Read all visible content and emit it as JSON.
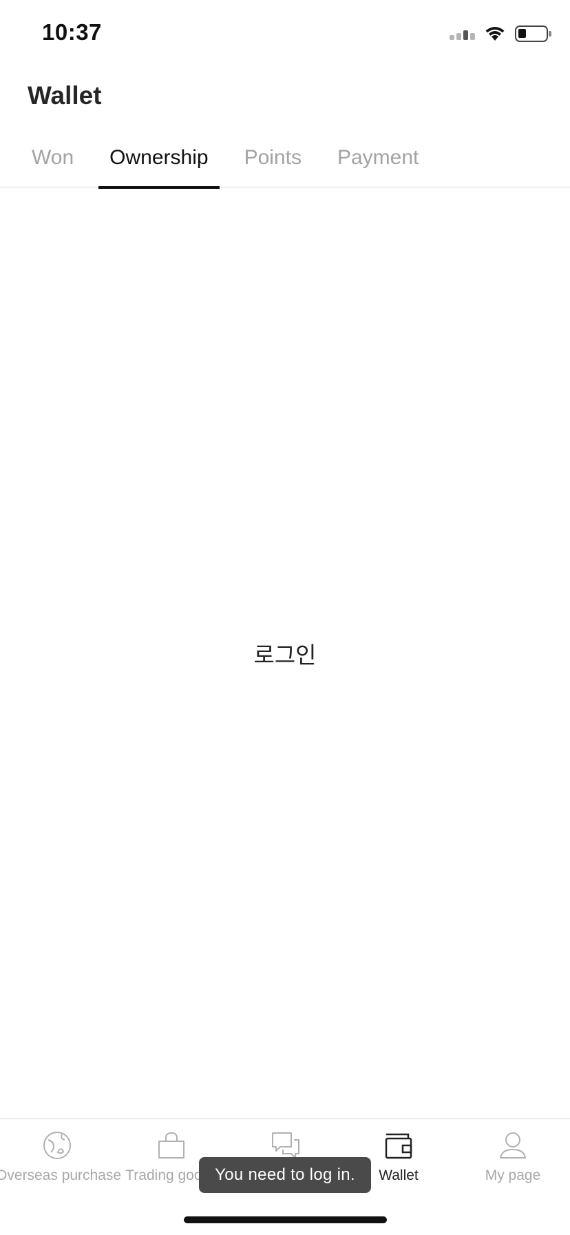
{
  "status_bar": {
    "time": "10:37",
    "icons": [
      "cellular-signal-icon",
      "wifi-icon",
      "battery-icon"
    ]
  },
  "header": {
    "title": "Wallet"
  },
  "tabs": [
    {
      "label": "Won",
      "active": false
    },
    {
      "label": "Ownership",
      "active": true
    },
    {
      "label": "Points",
      "active": false
    },
    {
      "label": "Payment",
      "active": false
    }
  ],
  "main": {
    "login_text": "로그인"
  },
  "bottom_nav": {
    "items": [
      {
        "label": "Overseas purchase",
        "icon": "globe-icon",
        "active": false
      },
      {
        "label": "Trading goods",
        "icon": "shopping-bag-icon",
        "active": false
      },
      {
        "label": "",
        "icon": "chat-icon",
        "active": false
      },
      {
        "label": "Wallet",
        "icon": "wallet-icon",
        "active": true
      },
      {
        "label": "My page",
        "icon": "user-icon",
        "active": false
      }
    ]
  },
  "toast": {
    "message": "You need to log in."
  },
  "colors": {
    "active_text": "#111111",
    "inactive_text": "#a3a3a3",
    "toast_background": "#4a4a4a"
  }
}
